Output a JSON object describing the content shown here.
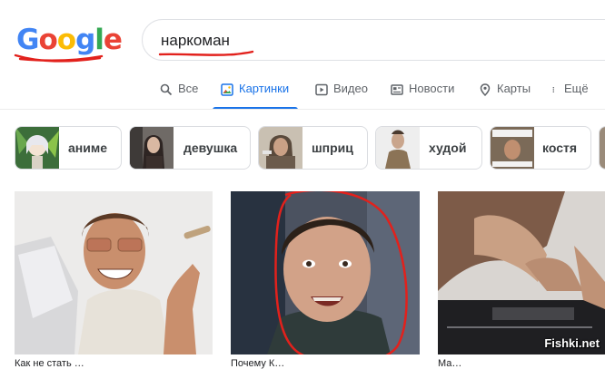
{
  "logo": {
    "letters": [
      "G",
      "o",
      "o",
      "g",
      "l",
      "e"
    ],
    "colors": [
      "#4285f4",
      "#ea4335",
      "#fbbc05",
      "#4285f4",
      "#34a853",
      "#ea4335"
    ]
  },
  "search": {
    "query": "наркоман"
  },
  "tabs": [
    {
      "label": "Все",
      "icon": "search-icon"
    },
    {
      "label": "Картинки",
      "icon": "image-icon",
      "active": true
    },
    {
      "label": "Видео",
      "icon": "play-icon"
    },
    {
      "label": "Новости",
      "icon": "news-icon"
    },
    {
      "label": "Карты",
      "icon": "map-pin-icon"
    },
    {
      "label": "Ещё",
      "icon": "more-vert-icon"
    }
  ],
  "chips": [
    {
      "label": "аниме"
    },
    {
      "label": "девушка"
    },
    {
      "label": "шприц"
    },
    {
      "label": "худой"
    },
    {
      "label": "костя"
    }
  ],
  "captions": [
    "Как не стать …",
    "Почему К…",
    "Ма…"
  ],
  "watermark": "Fishki.net",
  "colors": {
    "accent": "#1a73e8",
    "annotation": "#e2211c"
  }
}
